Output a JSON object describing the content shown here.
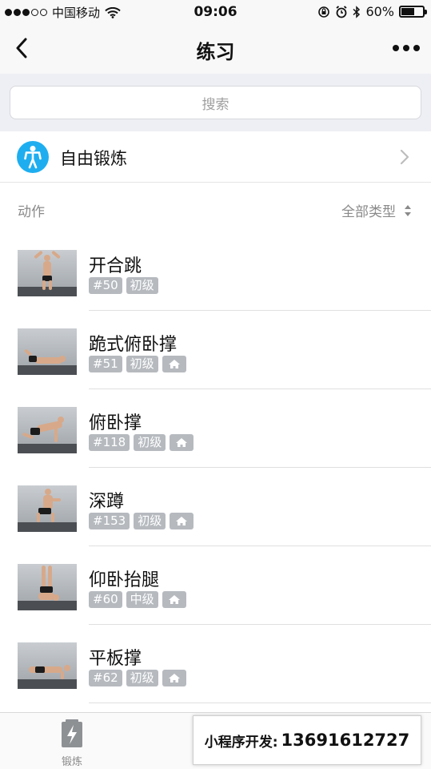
{
  "status_bar": {
    "carrier": "中国移动",
    "time": "09:06",
    "battery": "60%",
    "battery_level": 0.6
  },
  "nav": {
    "title": "练习"
  },
  "search": {
    "placeholder": "搜索"
  },
  "free_training": {
    "label": "自由锻炼",
    "icon": "person-icon"
  },
  "section": {
    "title": "动作",
    "filter": "全部类型"
  },
  "exercises": [
    {
      "name": "开合跳",
      "number": "#50",
      "level": "初级",
      "home": false
    },
    {
      "name": "跪式俯卧撑",
      "number": "#51",
      "level": "初级",
      "home": true
    },
    {
      "name": "俯卧撑",
      "number": "#118",
      "level": "初级",
      "home": true
    },
    {
      "name": "深蹲",
      "number": "#153",
      "level": "初级",
      "home": true
    },
    {
      "name": "仰卧抬腿",
      "number": "#60",
      "level": "中级",
      "home": true
    },
    {
      "name": "平板撑",
      "number": "#62",
      "level": "初级",
      "home": true
    }
  ],
  "tab_bar": {
    "items": [
      {
        "label": "锻炼",
        "icon": "lightning-icon"
      }
    ]
  },
  "promo": {
    "label": "小程序开发:",
    "phone": "13691612727"
  },
  "colors": {
    "accent": "#1eaef0",
    "tag": "#b6babf"
  }
}
